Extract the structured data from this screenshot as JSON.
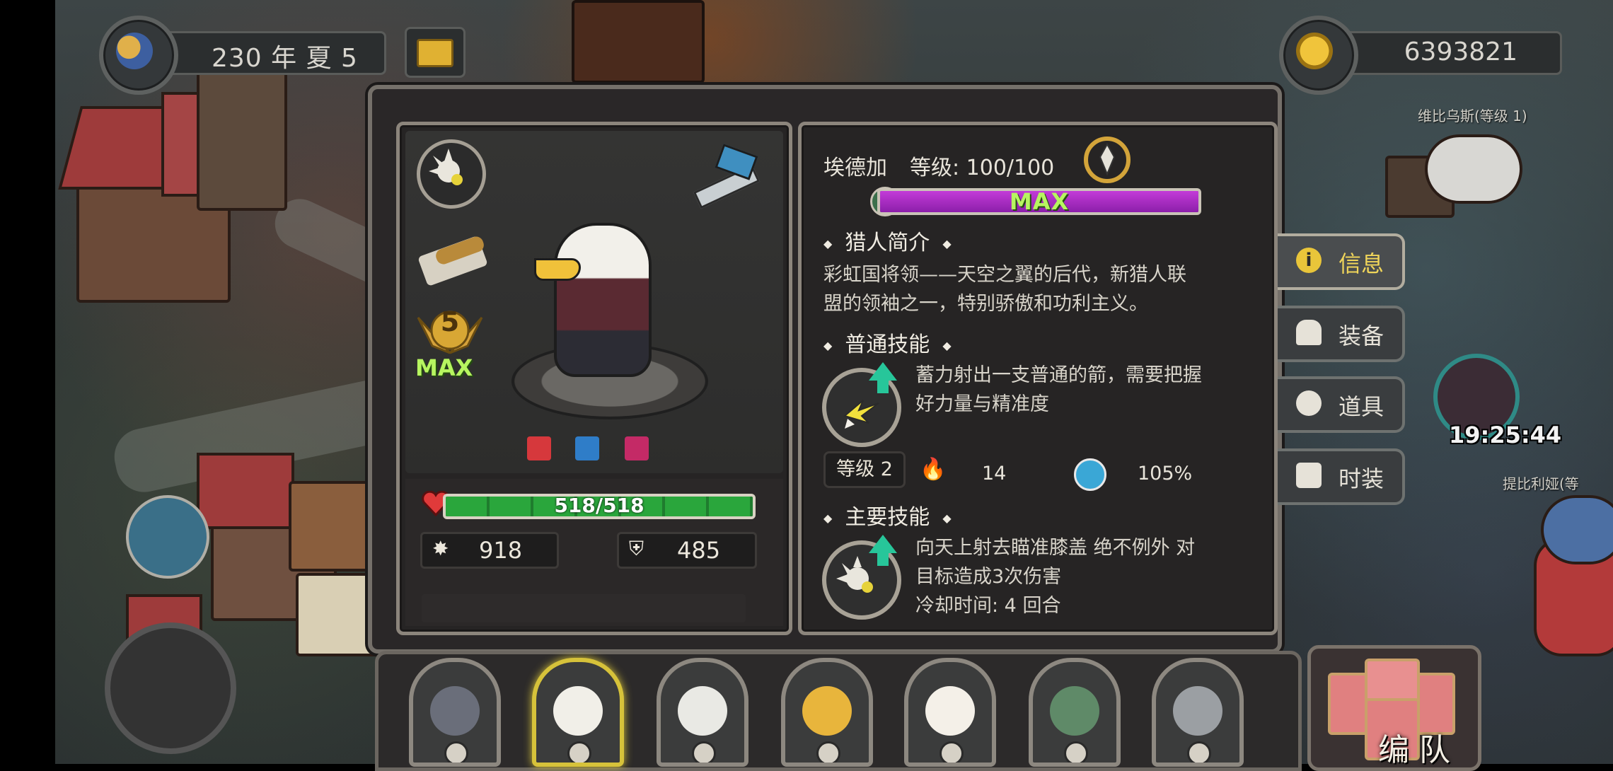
{
  "header": {
    "date": "230 年 夏 5",
    "gold": "6393821"
  },
  "character": {
    "hp": "518/518",
    "hp_fraction": 1.0,
    "attack": "918",
    "defense": "485",
    "star_level": "5",
    "star_max": "MAX"
  },
  "info": {
    "name": "埃德加",
    "level_label": "等级: 100/100",
    "level_fraction": 1.0,
    "level_bar_text": "MAX",
    "bio_title": "猎人简介",
    "bio_lines": [
      "彩虹国将领——天空之翼的后代，新猎人联",
      "盟的领袖之一，特别骄傲和功利主义。"
    ],
    "normal_skill_title": "普通技能",
    "normal_skill_lines": [
      "蓄力射出一支普通的箭，需要把握",
      "好力量与精准度"
    ],
    "normal_skill_level": "等级 2",
    "normal_skill_fire": "14",
    "normal_skill_percent": "105%",
    "main_skill_title": "主要技能",
    "main_skill_lines": [
      "向天上射去瞄准膝盖 绝不例外 对",
      "目标造成3次伤害",
      "冷却时间: 4 回合"
    ]
  },
  "tabs": [
    {
      "label": "信息",
      "icon": "info-icon",
      "active": true
    },
    {
      "label": "装备",
      "icon": "helmet-icon",
      "active": false
    },
    {
      "label": "道具",
      "icon": "potion-icon",
      "active": false
    },
    {
      "label": "时装",
      "icon": "shirt-icon",
      "active": false
    }
  ],
  "world": {
    "npc_1": "维比乌斯(等级 1)",
    "npc_2": "提比利娅(等",
    "timer": "19:25:44",
    "team_button": "编 队"
  },
  "colors": {
    "accent_gold": "#f0d55a",
    "hp_green": "#2aa63c",
    "level_purple": "#c33bd8",
    "max_text": "#b7f560"
  }
}
